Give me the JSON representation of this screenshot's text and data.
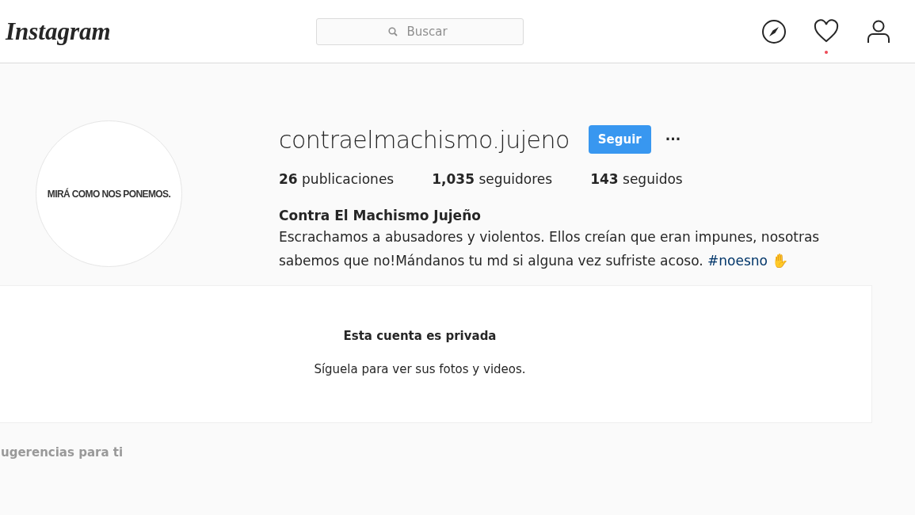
{
  "header": {
    "logo": "Instagram",
    "search": {
      "placeholder": "Buscar"
    },
    "notification": true
  },
  "profile": {
    "avatar_text": "MIRÁ COMO NOS PONEMOS.",
    "username": "contraelmachismo.jujeno",
    "follow_button": "Seguir",
    "more_button": "···",
    "stats": [
      {
        "count": "26",
        "label": "publicaciones"
      },
      {
        "count": "1,035",
        "label": "seguidores"
      },
      {
        "count": "143",
        "label": "seguidos"
      }
    ],
    "full_name": "Contra El Machismo Jujeño",
    "bio": "Escrachamos a abusadores y violentos. Ellos creían que eran impunes, nosotras sabemos que no!Mándanos tu md si alguna vez sufriste acoso.",
    "hashtag": "#noesno",
    "emoji": "✋"
  },
  "private_notice": {
    "title": "Esta cuenta es privada",
    "message": "Síguela para ver sus fotos y videos."
  },
  "suggestions": {
    "heading": "ugerencias para ti"
  }
}
